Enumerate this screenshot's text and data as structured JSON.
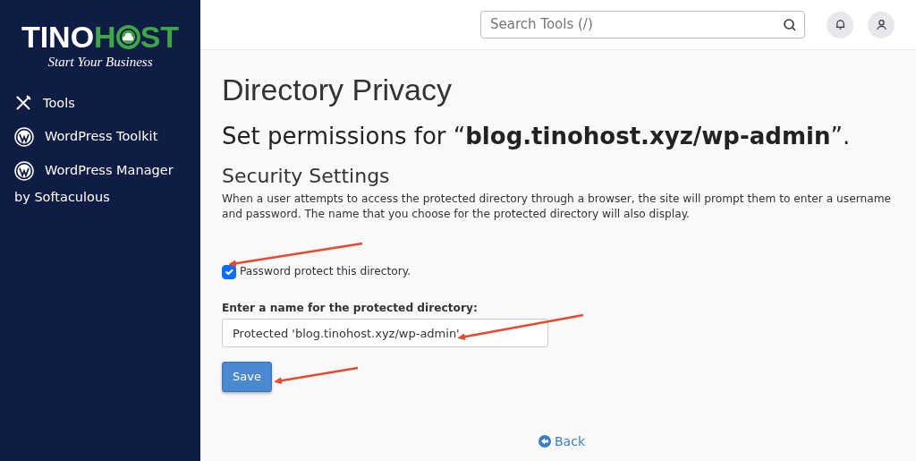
{
  "logo": {
    "part1": "TINO",
    "part2": "H",
    "part3": "ST",
    "tagline": "Start Your Business"
  },
  "sidebar": {
    "items": [
      {
        "kind": "tools",
        "label": "Tools"
      },
      {
        "kind": "wordpress",
        "label": "WordPress Toolkit"
      },
      {
        "kind": "wordpress",
        "label": "WordPress Manager",
        "sub": "by Softaculous"
      }
    ]
  },
  "search": {
    "placeholder": "Search Tools (/)"
  },
  "page_title": "Directory Privacy",
  "subtitle": "Set permissions for “**blog.tinohost.xyz/wp-admin**”.",
  "section_title": "Security Settings",
  "description": "When a user attempts to access the protected directory through a browser, the site will prompt them to enter a username and password. The name that you choose for the protected directory will also display.",
  "protect_checkbox": {
    "label": "Password protect this directory.",
    "checked": true
  },
  "name_field": {
    "label": "Enter a name for the protected directory:",
    "value": "Protected 'blog.tinohost.xyz/wp-admin'"
  },
  "save_button": "Save",
  "back_link": "Back"
}
